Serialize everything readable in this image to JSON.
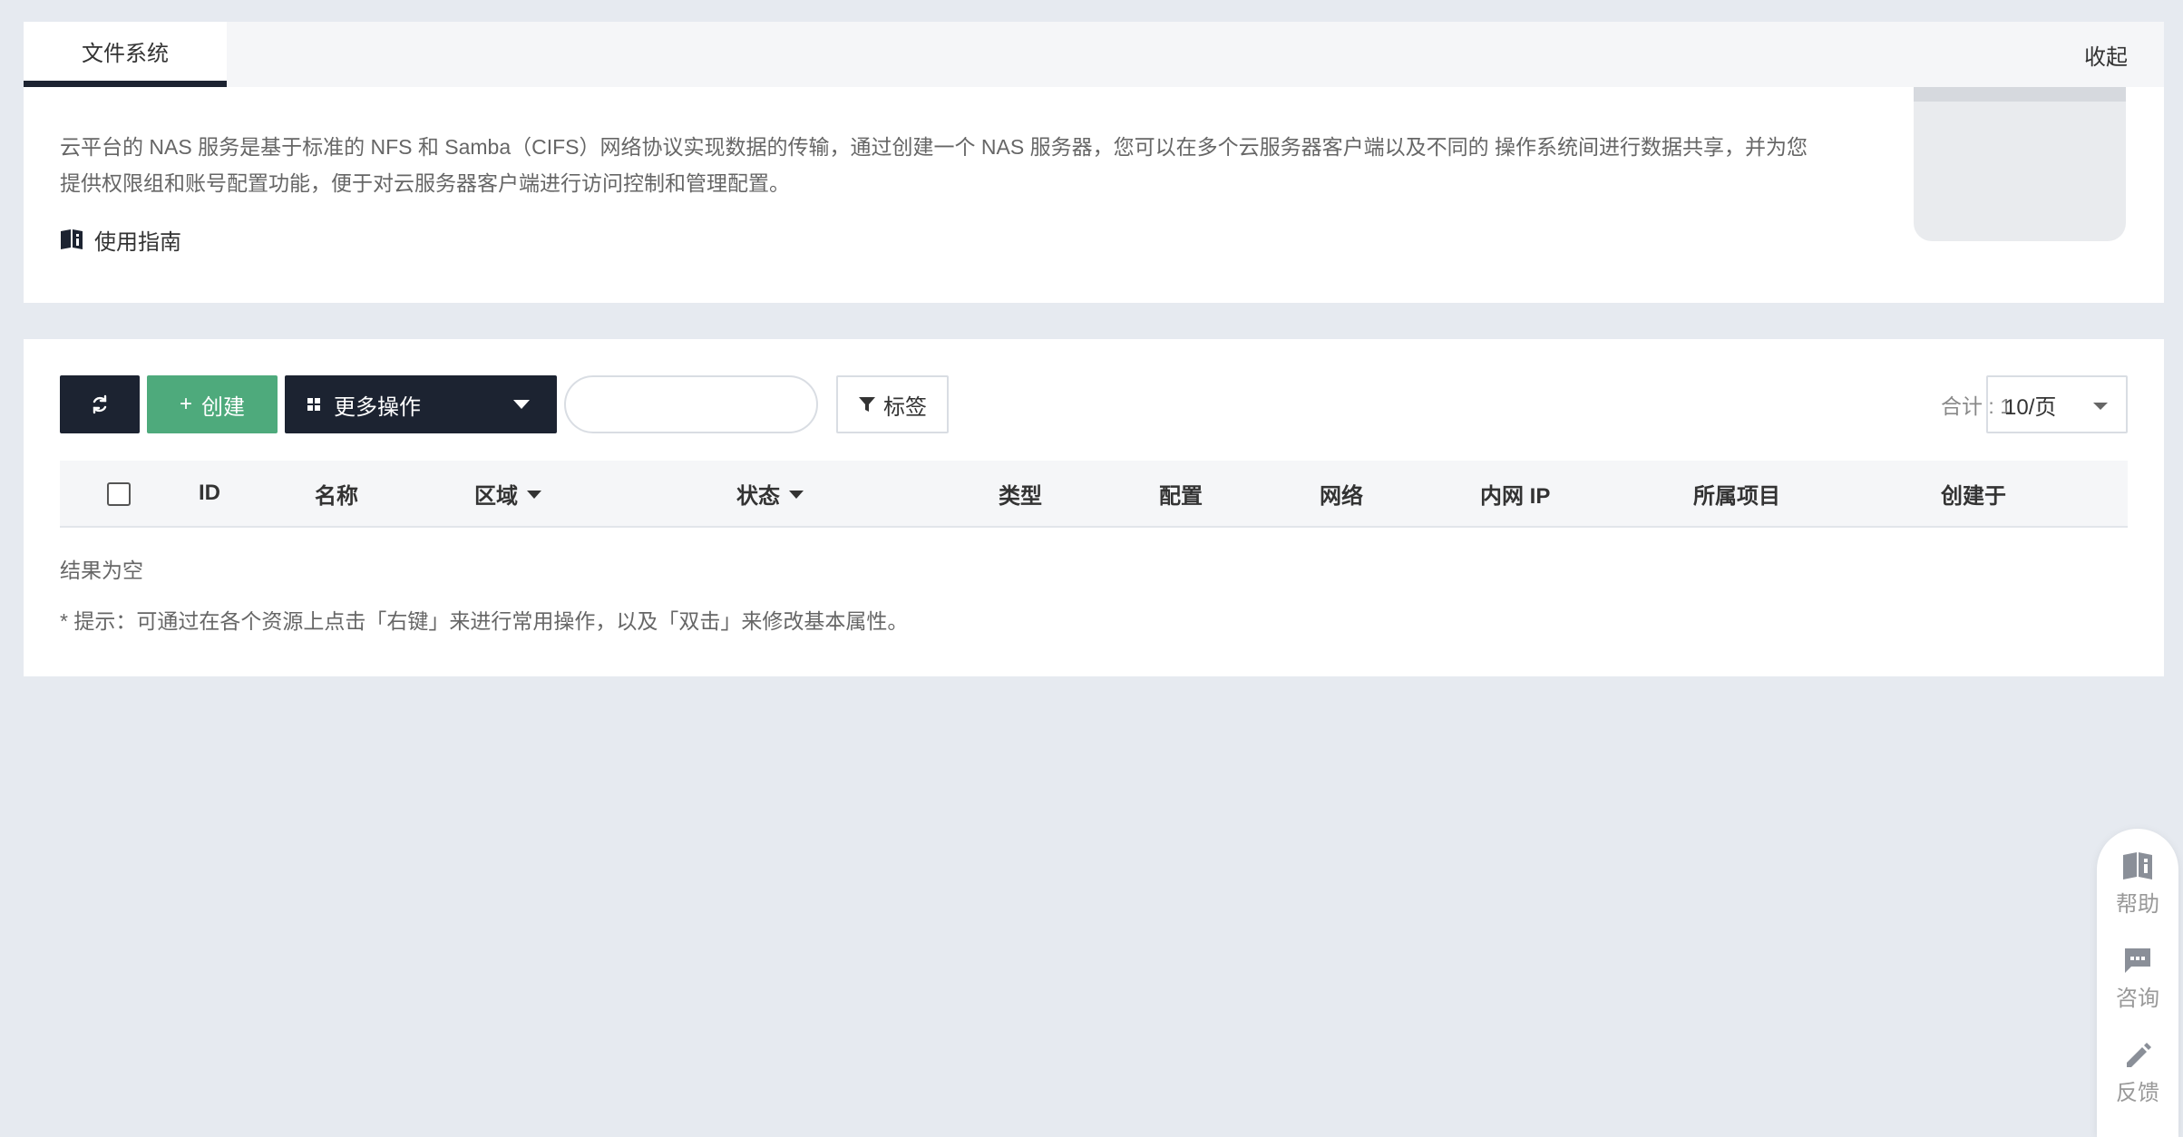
{
  "info": {
    "tab_label": "文件系统",
    "collapse_label": "收起",
    "description": "云平台的 NAS 服务是基于标准的 NFS 和 Samba（CIFS）网络协议实现数据的传输，通过创建一个 NAS 服务器，您可以在多个云服务器客户端以及不同的 操作系统间进行数据共享，并为您提供权限组和账号配置功能，便于对云服务器客户端进行访问控制和管理配置。",
    "guide_label": "使用指南"
  },
  "toolbar": {
    "refresh_icon": "refresh-icon",
    "create_label": "创建",
    "more_label": "更多操作",
    "search_placeholder": "",
    "tag_label": "标签",
    "total_label": "合计 : 1",
    "page_size": "10/页"
  },
  "table": {
    "columns": [
      "ID",
      "名称",
      "区域",
      "状态",
      "类型",
      "配置",
      "网络",
      "内网 IP",
      "所属项目",
      "创建于"
    ],
    "empty_text": "结果为空",
    "hint_text": "* 提示：可通过在各个资源上点击「右键」来进行常用操作，以及「双击」来修改基本属性。"
  },
  "float": {
    "help_label": "帮助",
    "consult_label": "咨询",
    "feedback_label": "反馈"
  },
  "colors": {
    "primary_dark": "#1c2331",
    "create_green": "#4eaa7c",
    "background": "#e6eaf0"
  }
}
